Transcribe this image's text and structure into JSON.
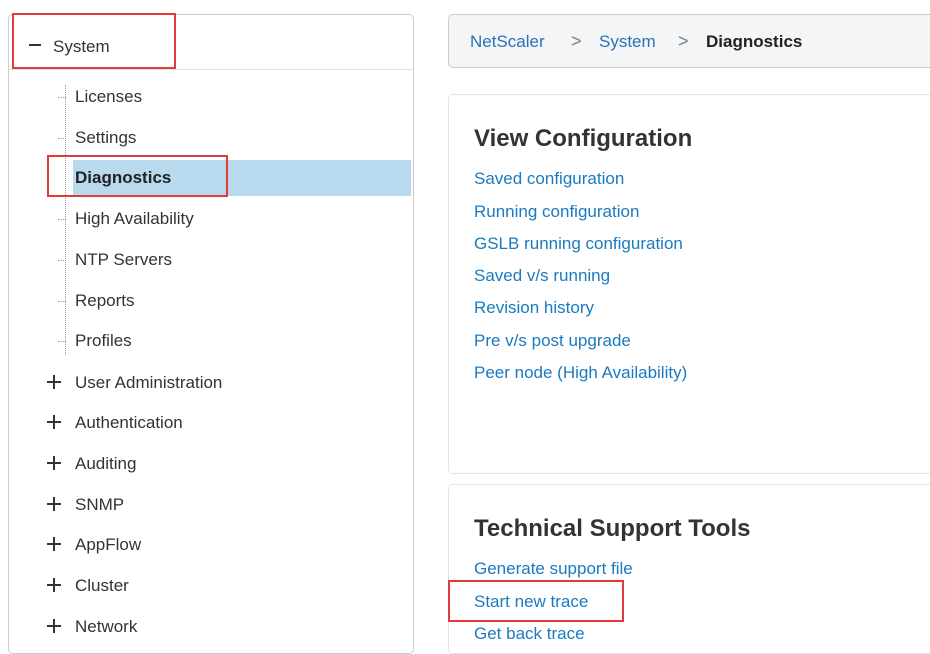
{
  "nav": {
    "root_label": "System",
    "children": [
      {
        "label": "Licenses"
      },
      {
        "label": "Settings"
      },
      {
        "label": "Diagnostics"
      },
      {
        "label": "High Availability"
      },
      {
        "label": "NTP Servers"
      },
      {
        "label": "Reports"
      },
      {
        "label": "Profiles"
      }
    ],
    "selected": "Diagnostics",
    "collapsed_groups": [
      {
        "label": "User Administration"
      },
      {
        "label": "Authentication"
      },
      {
        "label": "Auditing"
      },
      {
        "label": "SNMP"
      },
      {
        "label": "AppFlow"
      },
      {
        "label": "Cluster"
      },
      {
        "label": "Network"
      }
    ]
  },
  "breadcrumb": {
    "items": [
      {
        "label": "NetScaler"
      },
      {
        "label": "System"
      },
      {
        "label": "Diagnostics"
      }
    ],
    "separator": ">"
  },
  "view_configuration": {
    "title": "View Configuration",
    "links": [
      {
        "label": "Saved configuration"
      },
      {
        "label": "Running configuration"
      },
      {
        "label": "GSLB running configuration"
      },
      {
        "label": "Saved v/s running"
      },
      {
        "label": "Revision history"
      },
      {
        "label": "Pre v/s post upgrade"
      },
      {
        "label": "Peer node (High Availability)"
      }
    ]
  },
  "technical_support": {
    "title": "Technical Support Tools",
    "links": [
      {
        "label": "Generate support file"
      },
      {
        "label": "Start new trace"
      },
      {
        "label": "Get back trace"
      }
    ]
  },
  "colors": {
    "link": "#1a7ac0",
    "selected_bg": "#b9d9ee",
    "highlight": "#e13c3c"
  }
}
